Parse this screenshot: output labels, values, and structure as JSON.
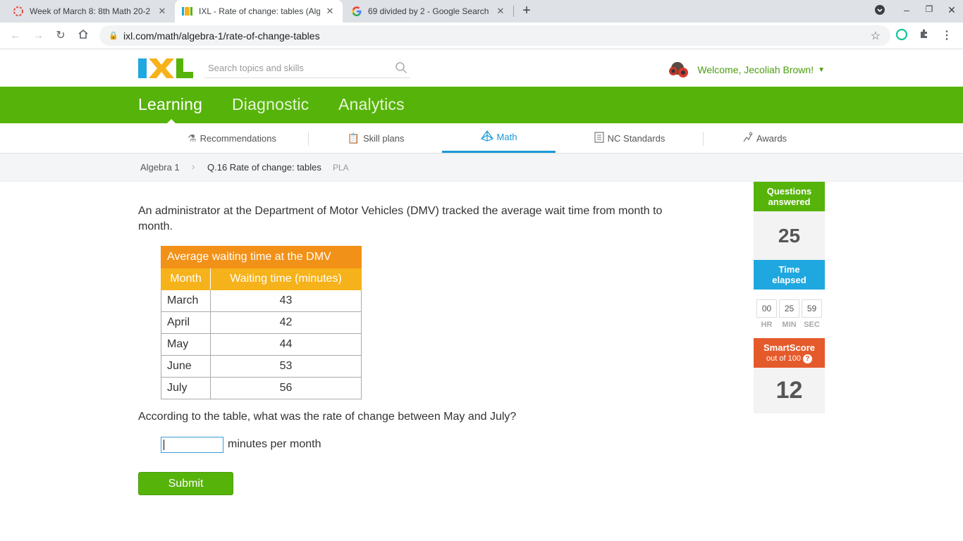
{
  "browser": {
    "tabs": [
      {
        "title": "Week of March 8: 8th Math 20-2",
        "active": false
      },
      {
        "title": "IXL - Rate of change: tables (Alg",
        "active": true
      },
      {
        "title": "69 divided by 2 - Google Search",
        "active": false
      }
    ],
    "url": "ixl.com/math/algebra-1/rate-of-change-tables"
  },
  "header": {
    "search_placeholder": "Search topics and skills",
    "welcome": "Welcome, Jecoliah Brown!"
  },
  "nav": {
    "items": [
      "Learning",
      "Diagnostic",
      "Analytics"
    ],
    "active": "Learning"
  },
  "subnav": {
    "items": [
      "Recommendations",
      "Skill plans",
      "Math",
      "NC Standards",
      "Awards"
    ],
    "active": "Math"
  },
  "breadcrumb": {
    "subject": "Algebra 1",
    "skill": "Q.16 Rate of change: tables",
    "tag": "PLA"
  },
  "question": {
    "text": "An administrator at the Department of Motor Vehicles (DMV) tracked the average wait time from month to month.",
    "table": {
      "caption": "Average waiting time at the DMV",
      "headers": [
        "Month",
        "Waiting time (minutes)"
      ],
      "rows": [
        [
          "March",
          "43"
        ],
        [
          "April",
          "42"
        ],
        [
          "May",
          "44"
        ],
        [
          "June",
          "53"
        ],
        [
          "July",
          "56"
        ]
      ]
    },
    "prompt": "According to the table, what was the rate of change between May and July?",
    "answer_value": "",
    "unit": "minutes per month",
    "submit_label": "Submit"
  },
  "stats": {
    "questions_label_1": "Questions",
    "questions_label_2": "answered",
    "questions_answered": "25",
    "time_label_1": "Time",
    "time_label_2": "elapsed",
    "hr": "00",
    "min": "25",
    "sec": "59",
    "hr_label": "HR",
    "min_label": "MIN",
    "sec_label": "SEC",
    "smartscore_label": "SmartScore",
    "smartscore_sub": "out of 100",
    "smartscore": "12"
  },
  "colors": {
    "ixl_green": "#56b30a",
    "table_caption": "#f29117",
    "table_header": "#f6b21b",
    "time_blue": "#1fa7df",
    "smartscore_orange": "#e55a2b"
  }
}
